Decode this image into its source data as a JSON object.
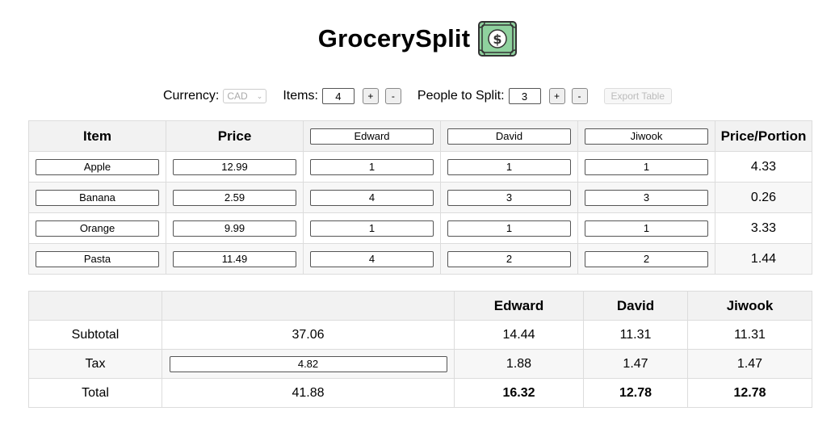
{
  "app": {
    "title": "GrocerySplit",
    "logo_icon": "money-bill-icon"
  },
  "controls": {
    "currency_label": "Currency:",
    "currency_value": "CAD",
    "items_label": "Items:",
    "items_count": "4",
    "people_label": "People to Split:",
    "people_count": "3",
    "plus": "+",
    "minus": "-",
    "export_label": "Export Table"
  },
  "items_table": {
    "headers": {
      "item": "Item",
      "price": "Price",
      "price_portion": "Price/Portion"
    },
    "people": [
      "Edward",
      "David",
      "Jiwook"
    ],
    "rows": [
      {
        "item": "Apple",
        "price": "12.99",
        "portions": [
          "1",
          "1",
          "1"
        ],
        "price_portion": "4.33"
      },
      {
        "item": "Banana",
        "price": "2.59",
        "portions": [
          "4",
          "3",
          "3"
        ],
        "price_portion": "0.26"
      },
      {
        "item": "Orange",
        "price": "9.99",
        "portions": [
          "1",
          "1",
          "1"
        ],
        "price_portion": "3.33"
      },
      {
        "item": "Pasta",
        "price": "11.49",
        "portions": [
          "4",
          "2",
          "2"
        ],
        "price_portion": "1.44"
      }
    ]
  },
  "summary_table": {
    "headers": [
      "Edward",
      "David",
      "Jiwook"
    ],
    "rows": [
      {
        "label": "Subtotal",
        "total": "37.06",
        "values": [
          "14.44",
          "11.31",
          "11.31"
        ]
      },
      {
        "label": "Tax",
        "total": "4.82",
        "values": [
          "1.88",
          "1.47",
          "1.47"
        ]
      },
      {
        "label": "Total",
        "total": "41.88",
        "values": [
          "16.32",
          "12.78",
          "12.78"
        ]
      }
    ]
  },
  "colors": {
    "header_bg": "#f2f2f2",
    "stripe_bg": "#f7f7f7",
    "border": "#dcdcdc",
    "bill_green": "#8fd19e"
  }
}
